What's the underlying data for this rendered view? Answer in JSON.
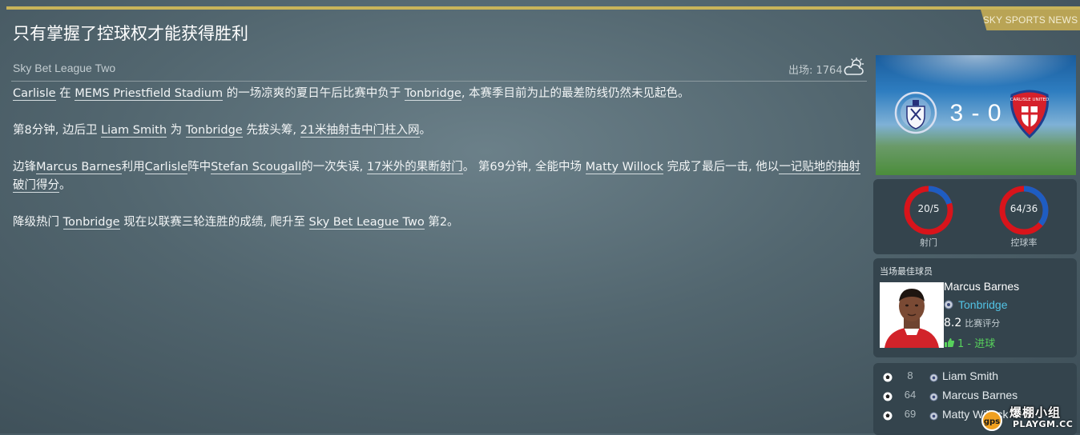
{
  "headline": "只有掌握了控球权才能获得胜利",
  "source_tag": "SKY SPORTS NEWS",
  "league": "Sky Bet League Two",
  "attendance": "出场: 1764",
  "weather_icon": "cloud-sun-icon",
  "story": {
    "p1": {
      "team_a": "Carlisle",
      "t1": " 在 ",
      "stadium": "MEMS Priestfield Stadium",
      "t2": " 的一场凉爽的夏日午后比赛中负于 ",
      "team_b": "Tonbridge",
      "t3": ", 本赛季目前为止的最差防线仍然未见起色。"
    },
    "p2": {
      "t1": "第8分钟, 边后卫 ",
      "player": "Liam Smith",
      "t2": " 为 ",
      "team": "Tonbridge",
      "t3": " 先拔头筹, ",
      "distance": "21米抽射击中门柱入网",
      "t4": "。"
    },
    "p3": {
      "t1": "边锋",
      "player_a": "Marcus Barnes",
      "t2": "利用",
      "team": "Carlisle",
      "t3": "阵中",
      "player_b": "Stefan Scougall",
      "t4": "的一次失误, ",
      "distance": "17米外的果断射门",
      "t5": "。 第69分钟, 全能中场 ",
      "player_c": "Matty Willock",
      "t6": " 完成了最后一击, 他以",
      "shot": "一记贴地的抽射破门得分",
      "t7": "。"
    },
    "p4": {
      "t1": "降级热门 ",
      "team": "Tonbridge",
      "t2": " 现在以联赛三轮连胜的成绩, 爬升至 ",
      "league": "Sky Bet League Two",
      "t3": " 第2。"
    }
  },
  "match": {
    "score": "3 - 0",
    "home_crest": "tonbridge-crest-icon",
    "away_crest": "carlisle-united-crest-icon",
    "away_crest_text": "CARLISLE UNITED"
  },
  "stats": {
    "shots": {
      "label": "20/5",
      "caption": "射门",
      "home": 20,
      "away": 5
    },
    "possession": {
      "label": "64/36",
      "caption": "控球率",
      "home": 64,
      "away": 36
    },
    "colors": {
      "home": "#d8141b",
      "away": "#1e5dc2"
    }
  },
  "motm": {
    "title": "当场最佳球员",
    "name": "Marcus Barnes",
    "club": "Tonbridge",
    "rating": "8.2",
    "rating_label": "比赛评分",
    "goals": "1 - 进球"
  },
  "scorers": [
    {
      "minute": "8",
      "name": "Liam Smith"
    },
    {
      "minute": "64",
      "name": "Marcus Barnes"
    },
    {
      "minute": "69",
      "name": "Matty Willock"
    }
  ],
  "watermark": {
    "text": "爆棚小组",
    "sub": "PLAYGM.CC"
  }
}
